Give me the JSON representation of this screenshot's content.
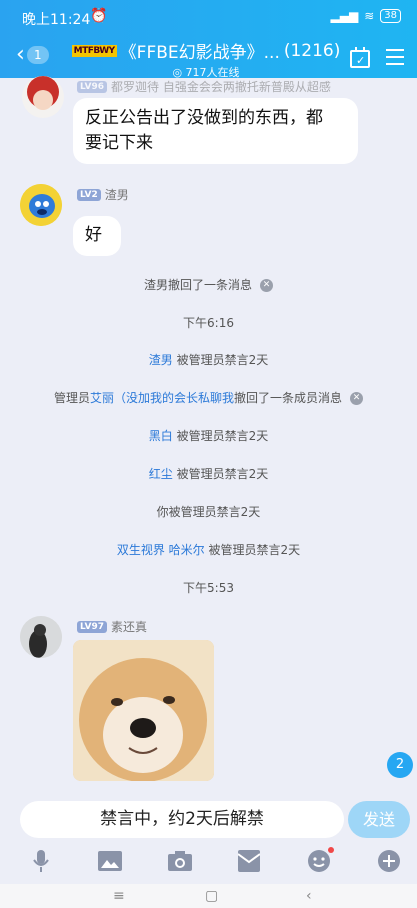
{
  "status": {
    "time": "晚上11:24",
    "battery": "38"
  },
  "header": {
    "back_count": "1",
    "tag": "MTFBWY",
    "title": "《FFBE幻影战争》...",
    "member_count": "(1216)",
    "online": "717人在线"
  },
  "messages": {
    "m1": {
      "level": "LV96",
      "sender_partial": "都罗迦待 自强金会会两撤托新普殿从超感",
      "text_line1": "反正公告出了没做到的东西，都",
      "text_line2": "要记下来"
    },
    "m2": {
      "level": "LV2",
      "sender": "渣男",
      "text": "好"
    },
    "m3": {
      "level": "LV97",
      "sender": "素还真"
    }
  },
  "system": {
    "recall1": "渣男撤回了一条消息",
    "time1": "下午6:16",
    "ban1_name": "渣男",
    "ban_suffix": "被管理员禁言2天",
    "admin_prefix": "管理员",
    "admin_name": "艾丽（没加我的会长私聊我",
    "admin_action": "撤回了一条成员消息",
    "ban2_name": "黑白",
    "ban3_name": "红尘",
    "ban_self": "你被管理员禁言2天",
    "ban4_name": "双生视界 哈米尔",
    "time2": "下午5:53"
  },
  "unread_badge": "2",
  "input": {
    "text": "禁言中，约2天后解禁",
    "send": "发送"
  },
  "toolbar_icons": [
    "microphone-icon",
    "image-icon",
    "camera-icon",
    "red-packet-icon",
    "emoji-icon",
    "plus-icon"
  ],
  "colors": {
    "header": "#1fb5f2",
    "accent": "#26a7f2",
    "link": "#2b79d8"
  }
}
